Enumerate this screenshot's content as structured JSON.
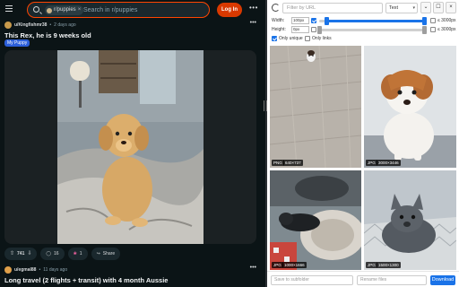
{
  "reddit": {
    "search": {
      "subreddit_chip": "r/puppies",
      "placeholder": "Search in r/puppies"
    },
    "login_label": "Log In",
    "more_label": "•••",
    "post1": {
      "author": "u/Kingfishmr38",
      "time": "2 days ago",
      "separator": "•",
      "title": "This Rex, he is 9 weeks old",
      "flair": "My Puppy",
      "votes": "741",
      "comments": "16",
      "awards": "1",
      "share_label": "Share"
    },
    "post2": {
      "author": "u/egmal88",
      "time": "11 days ago",
      "separator": "•",
      "title": "Long travel (2 flights + transit) with 4 month Aussie"
    }
  },
  "downloader": {
    "url_filter_placeholder": "Filter by URL",
    "type_select": "Text",
    "width_label": "Width:",
    "width_min": "100px",
    "width_max": "≤ 3000px",
    "height_label": "Height:",
    "height_min": "0px",
    "height_max": "≤ 3000px",
    "only_unique_label": "Only unique",
    "only_unique_checked": true,
    "only_links_label": "Only links",
    "only_links_checked": false,
    "images": [
      {
        "format": "PNG",
        "size": "640×737"
      },
      {
        "format": "JPG",
        "size": "3000×3446"
      },
      {
        "format": "JPG",
        "size": "1000×1666"
      },
      {
        "format": "JPG",
        "size": "1500×1300"
      }
    ],
    "subfolder_placeholder": "Save to subfolder",
    "rename_placeholder": "Rename files",
    "download_label": "Download",
    "accent_color": "#1a73e8"
  }
}
